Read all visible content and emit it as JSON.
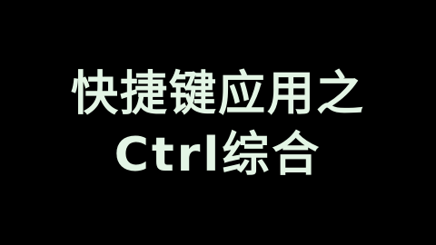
{
  "title_card": {
    "line_1": "快捷键应用之",
    "line_2": "Ctrl综合",
    "text_color": "#e3f5e5",
    "background_color": "#000000"
  }
}
